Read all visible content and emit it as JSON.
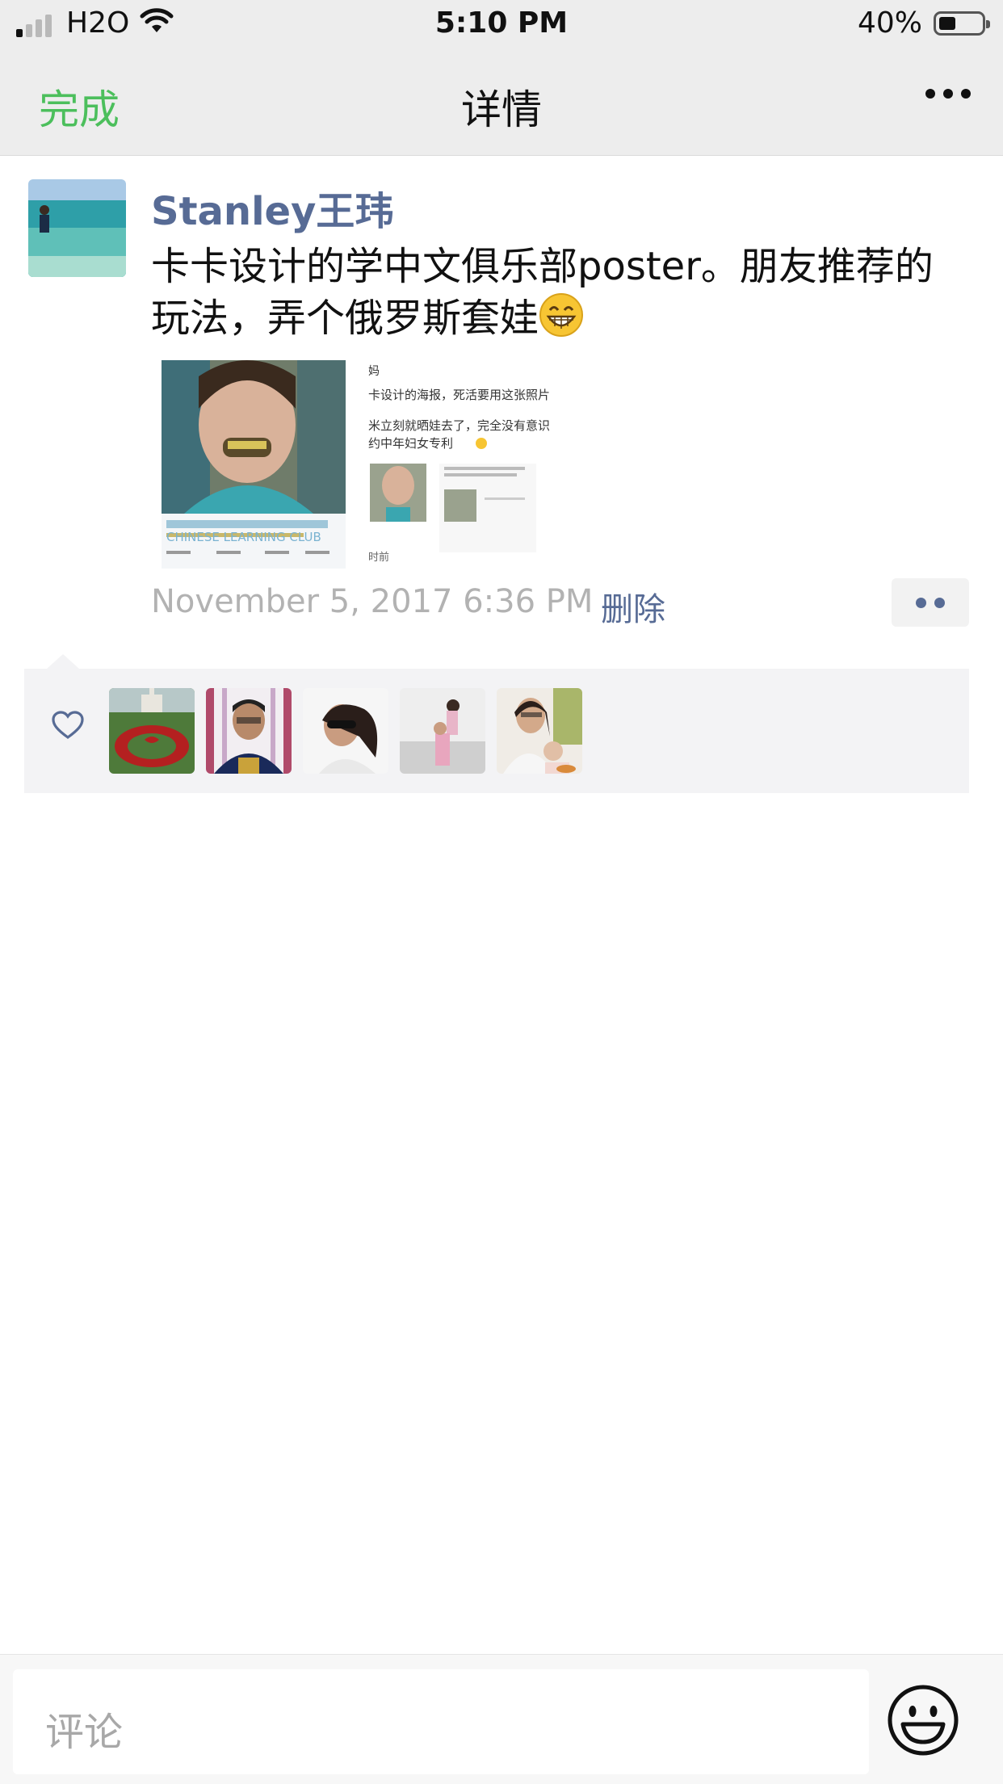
{
  "status_bar": {
    "carrier": "H2O",
    "time": "5:10 PM",
    "battery_percent": "40%",
    "battery_level": 0.4,
    "signal_bars_on": 1,
    "signal_bars_total": 4
  },
  "nav": {
    "done_label": "完成",
    "title": "详情",
    "more_icon": "more-dots-icon"
  },
  "post": {
    "username": "Stanley王玮",
    "text": "卡卡设计的学中文俱乐部poster。朋友推荐的玩法，弄个俄罗斯套娃",
    "emoji": "grinning-face-emoji",
    "image_caption_lines": [
      "CHINESE LEARNING CLUB",
      "卡设计的海报，死活要用这张照片",
      "米立刻就晒娃去了，完全没有意识",
      "约中年妇女专利",
      "时前"
    ],
    "timestamp": "November 5, 2017 6:36 PM",
    "delete_label": "删除"
  },
  "likes": {
    "heart_icon": "heart-outline-icon",
    "count_avatars": 5
  },
  "comment_bar": {
    "placeholder": "评论",
    "emoji_icon": "smiley-icon"
  },
  "colors": {
    "accent_green": "#4cbf5c",
    "link_blue": "#576b95",
    "bar_bg": "#ededed"
  }
}
